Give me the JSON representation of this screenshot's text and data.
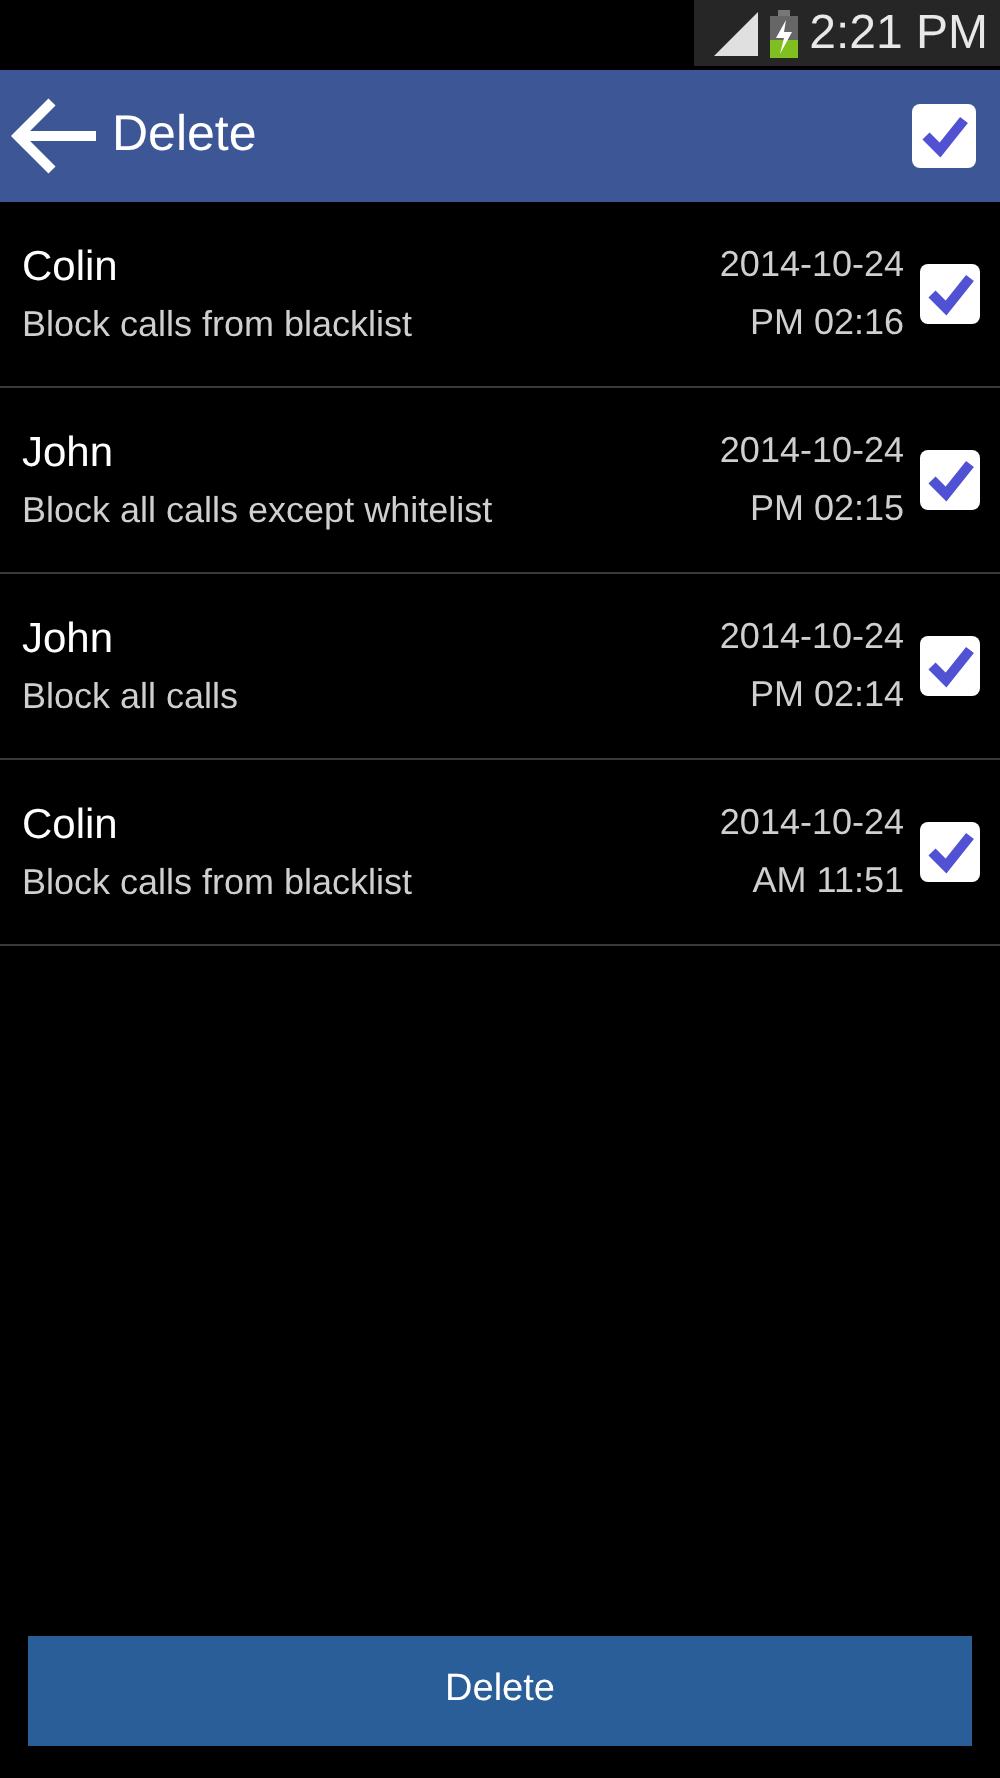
{
  "status_bar": {
    "time": "2:21 PM"
  },
  "header": {
    "title": "Delete",
    "select_all": {
      "checked": true
    }
  },
  "items": [
    {
      "name": "Colin",
      "description": "Block calls from blacklist",
      "date": "2014-10-24",
      "time": "PM 02:16",
      "checked": true
    },
    {
      "name": "John",
      "description": "Block all calls except whitelist",
      "date": "2014-10-24",
      "time": "PM 02:15",
      "checked": true
    },
    {
      "name": "John",
      "description": "Block all calls",
      "date": "2014-10-24",
      "time": "PM 02:14",
      "checked": true
    },
    {
      "name": "Colin",
      "description": "Block calls from blacklist",
      "date": "2014-10-24",
      "time": "AM 11:51",
      "checked": true
    }
  ],
  "footer": {
    "button": "Delete"
  }
}
